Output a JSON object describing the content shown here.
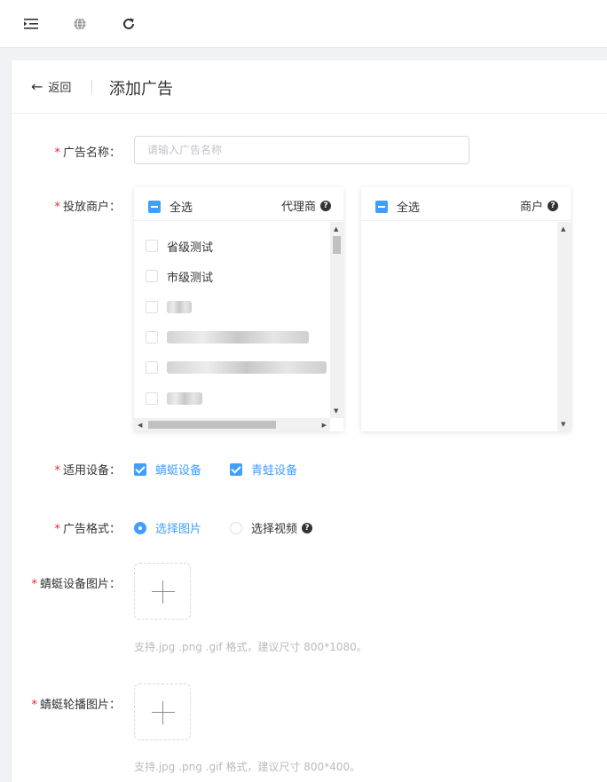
{
  "toolbar": {
    "icons": [
      "menu-fold-icon",
      "globe-icon",
      "refresh-icon"
    ]
  },
  "header": {
    "back_arrow": "←",
    "back_label": "返回",
    "title": "添加广告"
  },
  "form": {
    "required_mark": "*",
    "name": {
      "label": "广告名称：",
      "placeholder": "请输入广告名称",
      "value": ""
    },
    "merchants": {
      "label": "投放商户：",
      "left": {
        "select_all": "全选",
        "title": "代理商",
        "items": [
          {
            "label": "省级测试"
          },
          {
            "label": "市级测试"
          },
          {
            "label": "",
            "redacted": true
          },
          {
            "label": "",
            "redacted": true
          },
          {
            "label": "",
            "redacted": true
          },
          {
            "label": "",
            "redacted": true
          }
        ]
      },
      "right": {
        "select_all": "全选",
        "title": "商户",
        "items": []
      },
      "help_icon": "?"
    },
    "devices": {
      "label": "适用设备：",
      "options": [
        {
          "label": "蜻蜓设备",
          "checked": true
        },
        {
          "label": "青蛙设备",
          "checked": true
        }
      ]
    },
    "format": {
      "label": "广告格式：",
      "options": [
        {
          "label": "选择图片",
          "selected": true
        },
        {
          "label": "选择视频",
          "selected": false
        }
      ],
      "help_icon": "?"
    },
    "dragonfly_image": {
      "label": "蜻蜓设备图片：",
      "hint": "支持.jpg .png .gif 格式，建议尺寸 800*1080。"
    },
    "dragonfly_carousel": {
      "label": "蜻蜓轮播图片：",
      "hint": "支持.jpg .png .gif 格式，建议尺寸 800*400。"
    }
  },
  "colors": {
    "accent": "#409eff",
    "required": "#f5222d",
    "hint": "#bbbbbb",
    "page_bg": "#f0f2f5"
  }
}
